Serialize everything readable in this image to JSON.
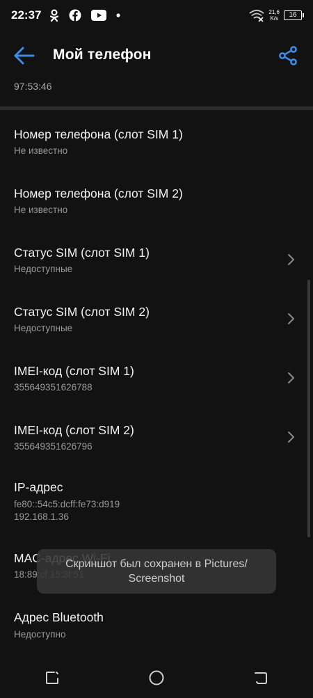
{
  "status_bar": {
    "time": "22:37",
    "net_speed_value": "21,6",
    "net_speed_unit": "K/s",
    "battery": "16",
    "icons": [
      "odnoklassniki-icon",
      "facebook-icon",
      "youtube-icon",
      "dot-icon",
      "wifi-icon",
      "battery-icon"
    ]
  },
  "app_bar": {
    "title": "Мой телефон",
    "icons": [
      "back-arrow-icon",
      "share-icon"
    ]
  },
  "previous_value": "97:53:46",
  "items": [
    {
      "label": "Номер телефона (слот SIM 1)",
      "values": [
        "Не известно"
      ],
      "chevron": false
    },
    {
      "label": "Номер телефона (слот SIM 2)",
      "values": [
        "Не известно"
      ],
      "chevron": false
    },
    {
      "label": "Статус SIM (слот SIM 1)",
      "values": [
        "Недоступные"
      ],
      "chevron": true
    },
    {
      "label": "Статус SIM (слот SIM 2)",
      "values": [
        "Недоступные"
      ],
      "chevron": true
    },
    {
      "label": "IMEI-код (слот SIM 1)",
      "values": [
        "355649351626788"
      ],
      "chevron": true
    },
    {
      "label": "IMEI-код (слот SIM 2)",
      "values": [
        "355649351626796"
      ],
      "chevron": true
    },
    {
      "label": "IP-адрес",
      "values": [
        "fe80::54c5:dcff:fe73:d919",
        "192.168.1.36"
      ],
      "chevron": false
    },
    {
      "label": "MAC-адрес Wi-Fi",
      "values": [
        "18:89:cf:15:3f:51"
      ],
      "chevron": false
    },
    {
      "label": "Адрес Bluetooth",
      "values": [
        "Недоступно"
      ],
      "chevron": false
    }
  ],
  "toast": {
    "line1": "Скриншот был сохранен в  Pictures/",
    "line2": "Screenshot"
  },
  "nav_bar": {
    "icons": [
      "recent-apps-icon",
      "home-icon",
      "back-icon"
    ]
  },
  "colors": {
    "background": "#121212",
    "accent": "#3d8ce8",
    "secondary_text": "#9a9a9a"
  }
}
